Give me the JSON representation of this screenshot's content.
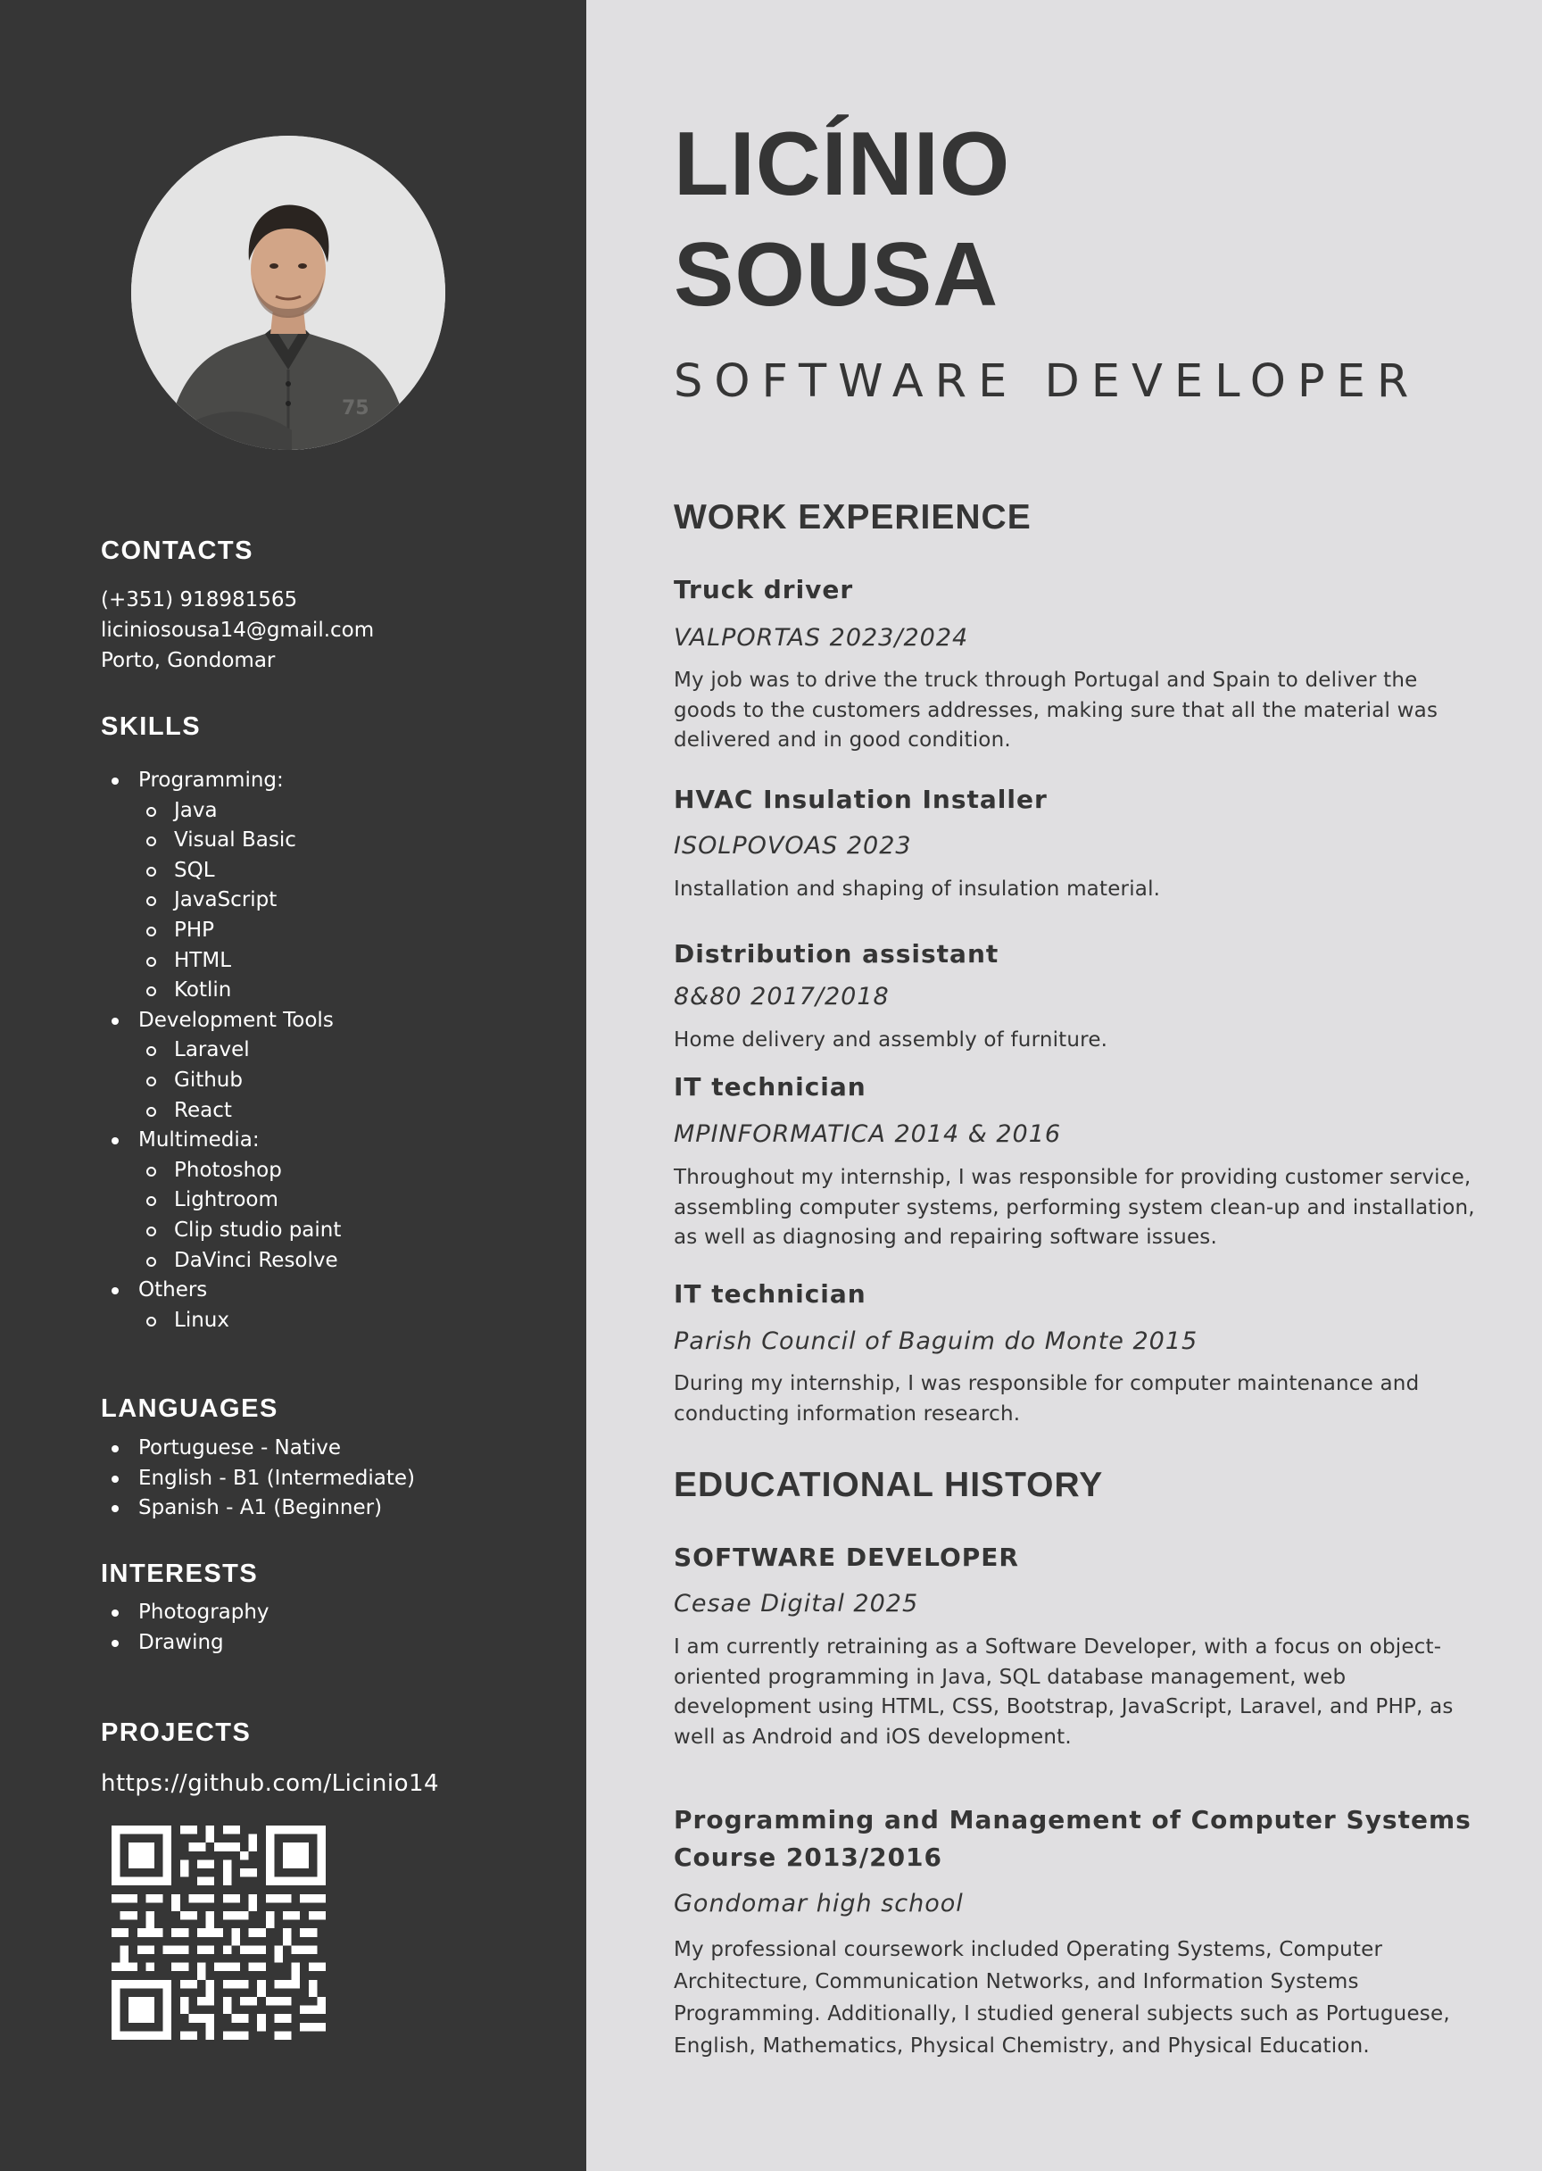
{
  "profile": {
    "first_name": "LICÍNIO",
    "last_name": "SOUSA",
    "role": "SOFTWARE DEVELOPER"
  },
  "contacts": {
    "heading": "CONTACTS",
    "phone": "(+351) 918981565",
    "email": "liciniosousa14@gmail.com",
    "location": "Porto, Gondomar"
  },
  "skills": {
    "heading": "SKILLS",
    "groups": [
      {
        "label": "Programming:",
        "items": [
          "Java",
          "Visual Basic",
          "SQL",
          "JavaScript",
          "PHP",
          "HTML",
          "Kotlin"
        ]
      },
      {
        "label": "Development Tools",
        "items": [
          "Laravel",
          "Github",
          "React"
        ]
      },
      {
        "label": "Multimedia:",
        "items": [
          "Photoshop",
          "Lightroom",
          "Clip studio paint",
          "DaVinci Resolve"
        ]
      },
      {
        "label": "Others",
        "items": [
          "Linux"
        ]
      }
    ]
  },
  "languages": {
    "heading": "LANGUAGES",
    "items": [
      "Portuguese - Native",
      "English - B1 (Intermediate)",
      "Spanish - A1 (Beginner)"
    ]
  },
  "interests": {
    "heading": "INTERESTS",
    "items": [
      "Photography",
      "Drawing"
    ]
  },
  "projects": {
    "heading": "PROJECTS",
    "link": "https://github.com/Licinio14"
  },
  "work": {
    "heading": "WORK EXPERIENCE",
    "jobs": [
      {
        "title": "Truck driver",
        "company": "VALPORTAS 2023/2024",
        "desc": "My job was to drive the truck through Portugal and Spain to deliver the goods to the customers addresses, making sure that all the material was delivered and in good condition."
      },
      {
        "title": "HVAC Insulation Installer",
        "company": "ISOLPOVOAS 2023",
        "desc": "Installation and shaping of insulation material."
      },
      {
        "title": "Distribution assistant",
        "company": "8&80 2017/2018",
        "desc": "Home delivery and assembly of furniture."
      },
      {
        "title": "IT technician",
        "company": "MPINFORMATICA 2014 & 2016",
        "desc": "Throughout my internship, I was responsible for providing customer service, assembling computer systems, performing system clean-up and installation, as well as diagnosing and repairing software issues."
      },
      {
        "title": "IT technician",
        "company": "Parish Council of Baguim do Monte 2015",
        "desc": "During my internship, I was responsible for computer maintenance and conducting information research."
      }
    ]
  },
  "education": {
    "heading": "EDUCATIONAL HISTORY",
    "items": [
      {
        "title": "SOFTWARE DEVELOPER",
        "school": "Cesae Digital 2025",
        "desc": "I am currently retraining as a Software Developer, with a focus on object-oriented programming in Java, SQL database management, web development using HTML, CSS, Bootstrap, JavaScript, Laravel, and PHP, as well as Android and iOS development."
      },
      {
        "title": "Programming and Management of Computer Systems Course 2013/2016",
        "school": "Gondomar high school",
        "desc": "My professional coursework included Operating Systems, Computer Architecture, Communication Networks, and Information Systems Programming. Additionally, I studied general subjects such as Portuguese, English, Mathematics, Physical Chemistry, and Physical Education."
      }
    ]
  }
}
